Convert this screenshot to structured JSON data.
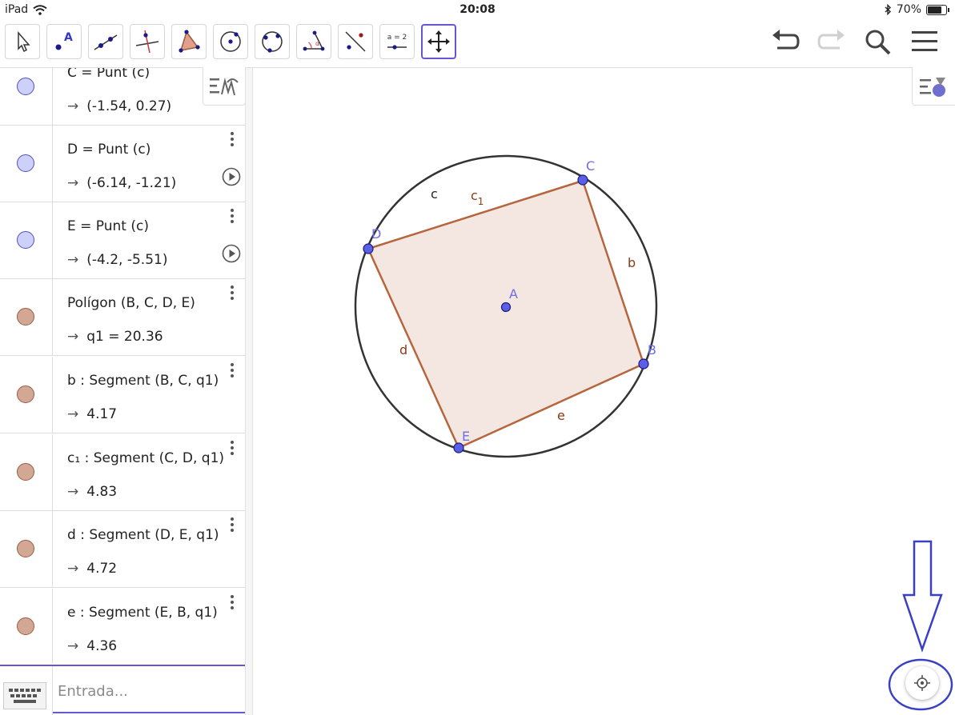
{
  "status": {
    "device": "iPad",
    "time": "20:08",
    "battery": "70%"
  },
  "toolbar": {
    "tools": [
      {
        "name": "move-tool-icon"
      },
      {
        "name": "point-tool-icon"
      },
      {
        "name": "line-tool-icon"
      },
      {
        "name": "perpendicular-line-tool-icon"
      },
      {
        "name": "polygon-tool-icon"
      },
      {
        "name": "circle-center-point-tool-icon"
      },
      {
        "name": "circle-three-points-tool-icon"
      },
      {
        "name": "angle-tool-icon"
      },
      {
        "name": "reflect-tool-icon"
      },
      {
        "name": "slider-tool-icon",
        "label": "a = 2"
      },
      {
        "name": "move-graphics-view-tool-icon",
        "active": true
      }
    ]
  },
  "algebra": {
    "rows": [
      {
        "definition": "C = Punt (c)",
        "value": "(-1.54,  0.27)",
        "kind": "point"
      },
      {
        "definition": "D = Punt (c)",
        "value": "(-6.14,  -1.21)",
        "kind": "point"
      },
      {
        "definition": "E = Punt (c)",
        "value": "(-4.2,  -5.51)",
        "kind": "point"
      },
      {
        "definition": "Polígon (B, C, D, E)",
        "value": "q1  =  20.36",
        "kind": "seg"
      },
      {
        "definition": "b : Segment (B, C, q1)",
        "value": "4.17",
        "kind": "seg"
      },
      {
        "definition": "c₁ : Segment (C, D, q1)",
        "value": "4.83",
        "kind": "seg"
      },
      {
        "definition": "d : Segment (D, E, q1)",
        "value": "4.72",
        "kind": "seg"
      },
      {
        "definition": "e : Segment (E, B, q1)",
        "value": "4.36",
        "kind": "seg"
      }
    ],
    "arrow": "→"
  },
  "input": {
    "placeholder": "Entrada..."
  },
  "graphics": {
    "labels": {
      "A": "A",
      "B": "B",
      "C": "C",
      "D": "D",
      "E": "E",
      "circle": "c",
      "b": "b",
      "c1": "c",
      "c1_sub": "1",
      "d": "d",
      "e": "e"
    },
    "colors": {
      "point": "#5b5fe8",
      "point_label": "#6d6de6",
      "segment": "#b5663d",
      "segment_label": "#8a3a14",
      "polygon_fill": "#f4e6e1",
      "circle": "#333333",
      "annotation": "#3a3fc4"
    }
  }
}
